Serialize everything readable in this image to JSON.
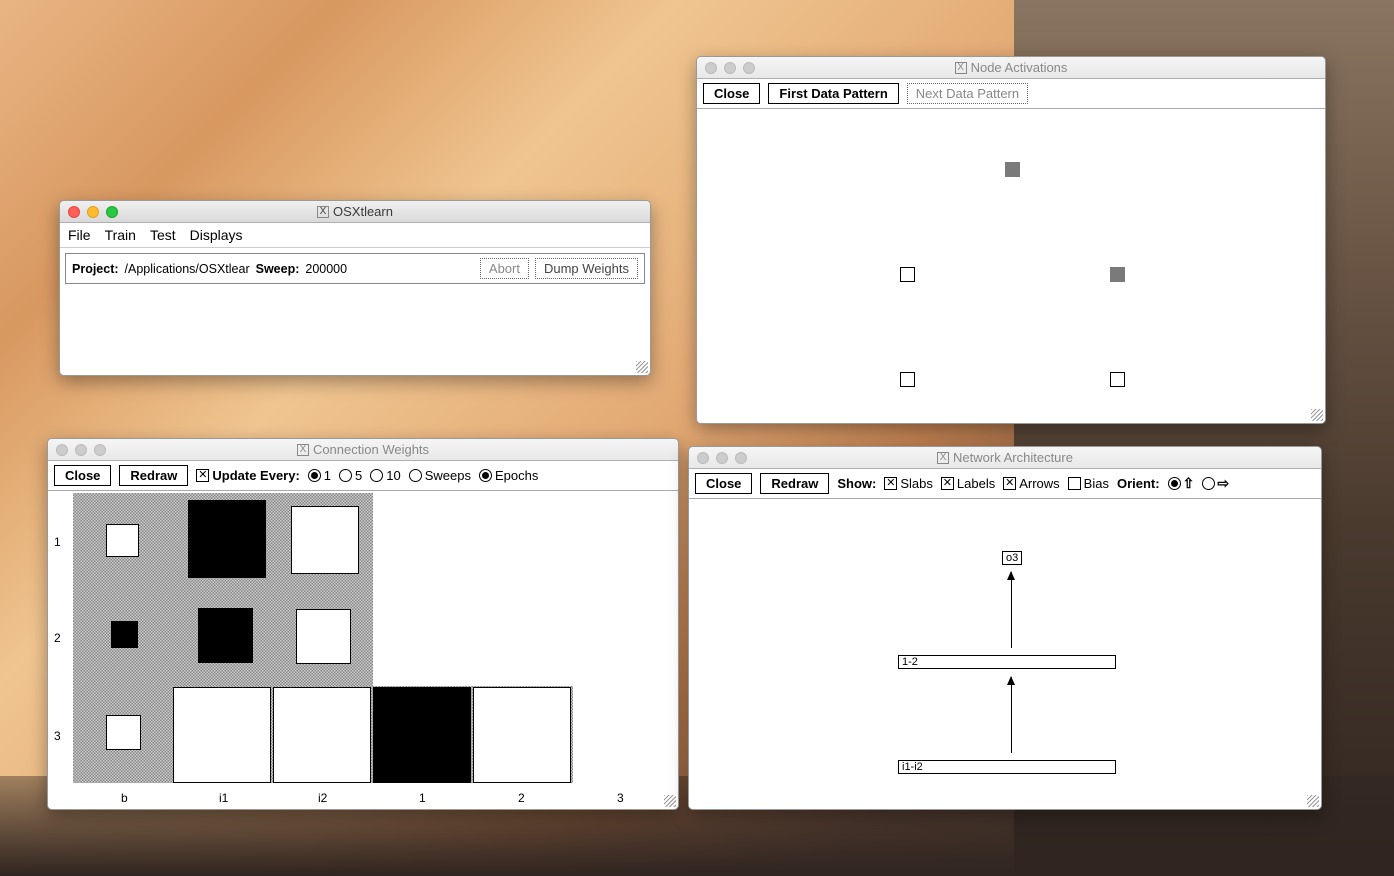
{
  "main": {
    "title": "OSXtlearn",
    "menu": [
      "File",
      "Train",
      "Test",
      "Displays"
    ],
    "project_label": "Project:",
    "project_path": "/Applications/OSXtlear",
    "sweep_label": "Sweep:",
    "sweep_value": "200000",
    "abort": "Abort",
    "dump": "Dump Weights"
  },
  "node_act": {
    "title": "Node Activations",
    "close": "Close",
    "first": "First Data Pattern",
    "next": "Next Data Pattern"
  },
  "conn": {
    "title": "Connection Weights",
    "close": "Close",
    "redraw": "Redraw",
    "update_label": "Update Every:",
    "opts": {
      "one": "1",
      "five": "5",
      "ten": "10",
      "sweeps": "Sweeps",
      "epochs": "Epochs"
    },
    "rows": [
      "1",
      "2",
      "3"
    ],
    "cols": [
      "b",
      "i1",
      "i2",
      "1",
      "2",
      "3"
    ]
  },
  "arch": {
    "title": "Network Architecture",
    "close": "Close",
    "redraw": "Redraw",
    "show_label": "Show:",
    "opts": {
      "slabs": "Slabs",
      "labels": "Labels",
      "arrows": "Arrows",
      "bias": "Bias"
    },
    "orient_label": "Orient:",
    "output": "o3",
    "hidden": "1-2",
    "input": "i1-i2"
  }
}
